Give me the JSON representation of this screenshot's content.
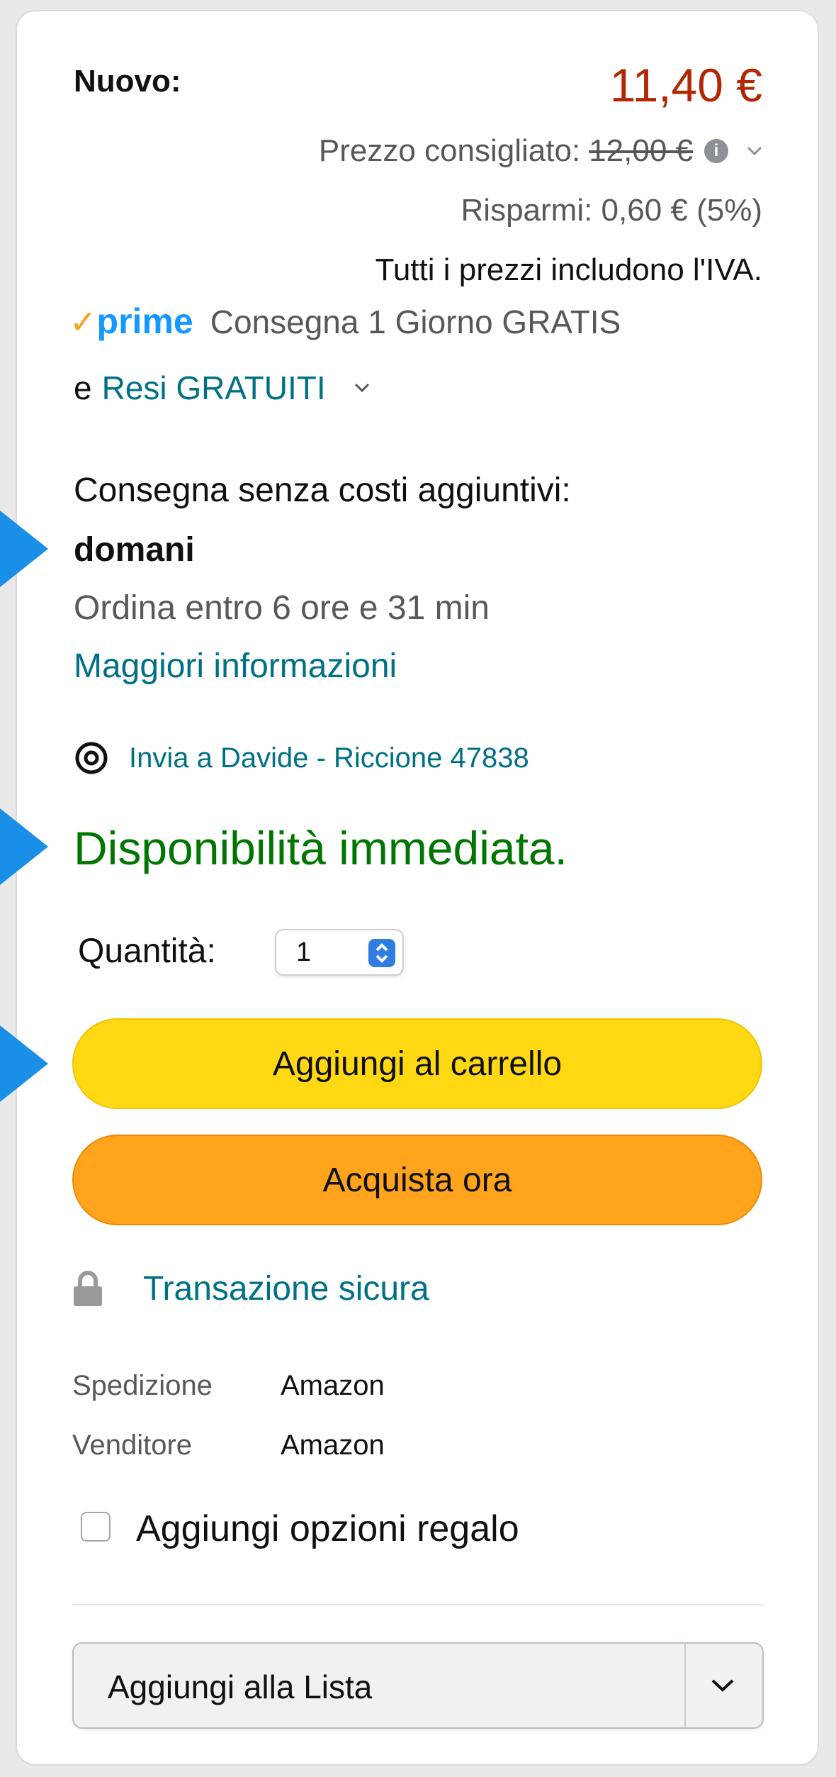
{
  "price": {
    "condition_label": "Nuovo:",
    "amount": "11,40 €",
    "list_price_label": "Prezzo consigliato:",
    "list_price": "12,00 €",
    "savings": "Risparmi: 0,60 € (5%)",
    "vat_note": "Tutti i prezzi includono l'IVA."
  },
  "prime": {
    "check": "✓",
    "logo": "prime",
    "delivery": "Consegna 1 Giorno GRATIS",
    "conj": "e",
    "returns_link": "Resi GRATUITI"
  },
  "delivery": {
    "line1": "Consegna senza costi aggiuntivi:",
    "date": "domani",
    "order_within": "Ordina entro 6 ore e 31 min",
    "more_info_link": "Maggiori informazioni",
    "ship_to": "Invia a Davide - Riccione 47838"
  },
  "availability": "Disponibilità immediata.",
  "quantity": {
    "label": "Quantità:",
    "value": "1"
  },
  "buttons": {
    "add_to_cart": "Aggiungi al carrello",
    "buy_now": "Acquista ora"
  },
  "secure": {
    "link": "Transazione sicura"
  },
  "seller_info": [
    {
      "label": "Spedizione",
      "value": "Amazon"
    },
    {
      "label": "Venditore",
      "value": "Amazon"
    }
  ],
  "gift": {
    "label": "Aggiungi opzioni regalo",
    "checked": false
  },
  "add_to_list": {
    "label": "Aggiungi alla Lista"
  },
  "colors": {
    "price": "#b12704",
    "link": "#007185",
    "in_stock": "#007600",
    "cart_button": "#ffd814",
    "buy_button": "#ffa41c",
    "prime": "#1399ff",
    "annotation_arrow": "#1a8fe8"
  }
}
